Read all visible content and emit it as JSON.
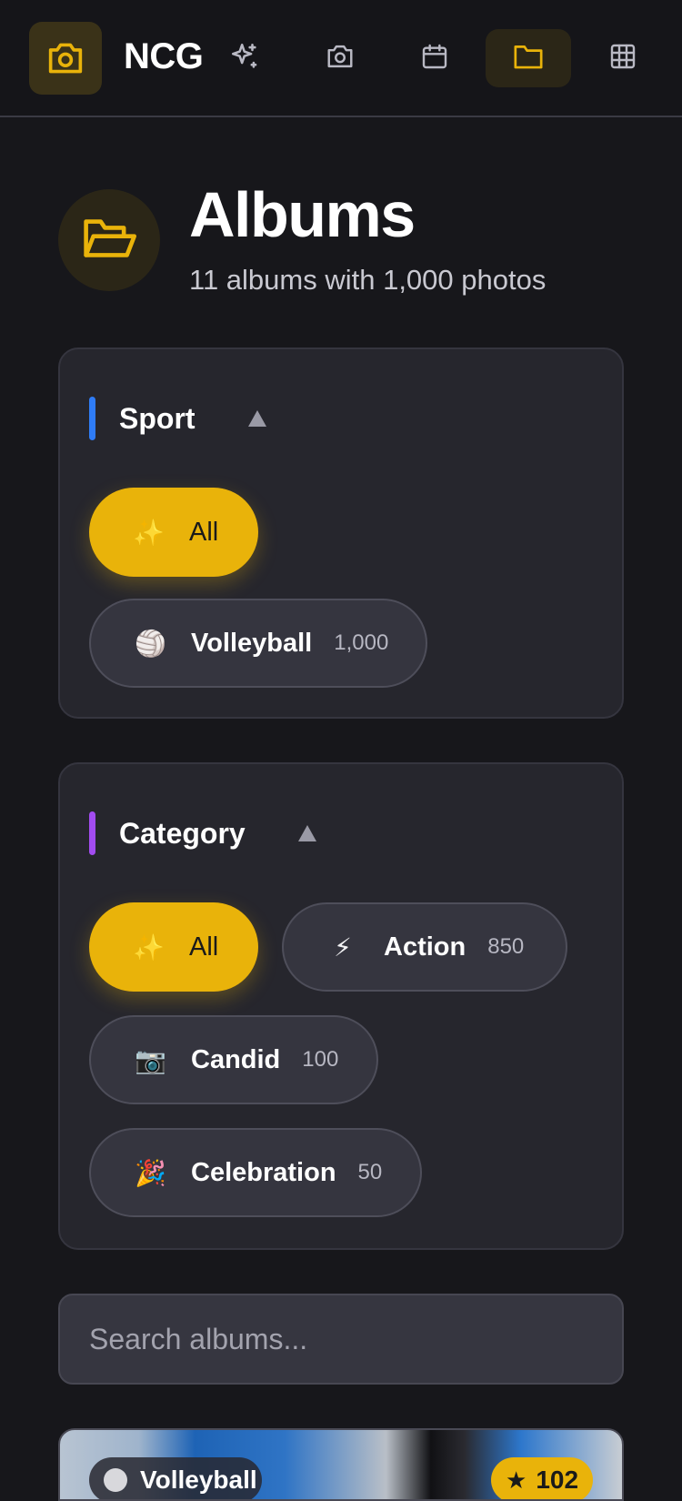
{
  "app": {
    "brand": "NCG",
    "nav": [
      {
        "icon": "sparkles-icon",
        "active": false
      },
      {
        "icon": "camera-icon",
        "active": false
      },
      {
        "icon": "calendar-icon",
        "active": false
      },
      {
        "icon": "folder-icon",
        "active": true
      },
      {
        "icon": "grid-icon",
        "active": false
      }
    ],
    "accent_color": "#e9b30a"
  },
  "header": {
    "title": "Albums",
    "subtitle": "11 albums with 1,000 photos"
  },
  "sport_filter": {
    "title": "Sport",
    "accent": "#2f7cf6",
    "chips": [
      {
        "emoji": "✨",
        "label": "All",
        "selected": true
      },
      {
        "emoji": "🏐",
        "label": "Volleyball",
        "count": "1,000",
        "selected": false
      }
    ]
  },
  "category_filter": {
    "title": "Category",
    "accent": "#a24cf0",
    "chips": [
      {
        "emoji": "✨",
        "label": "All",
        "selected": true
      },
      {
        "emoji": "⚡",
        "label": "Action",
        "count": "850",
        "selected": false
      },
      {
        "emoji": "📷",
        "label": "Candid",
        "count": "100",
        "selected": false
      },
      {
        "emoji": "🎉",
        "label": "Celebration",
        "count": "50",
        "selected": false
      }
    ]
  },
  "search": {
    "placeholder": "Search albums..."
  },
  "album_card": {
    "sport_label": "Volleyball",
    "badge_star": "★",
    "badge_count": "102"
  }
}
